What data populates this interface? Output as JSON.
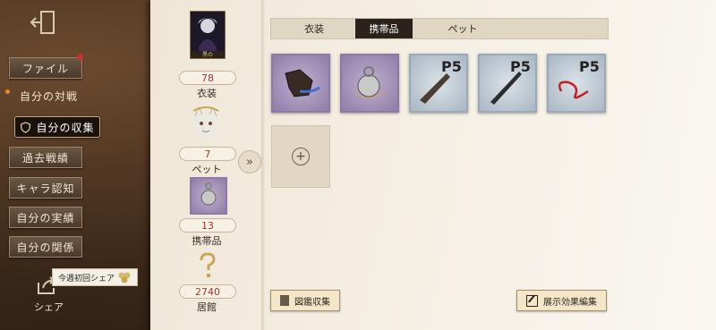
{
  "sidebar": {
    "items": [
      {
        "label": "ファイル"
      },
      {
        "label": "自分の対戦"
      },
      {
        "label": "自分の収集"
      },
      {
        "label": "過去戦績"
      },
      {
        "label": "キャラ認知"
      },
      {
        "label": "自分の実績"
      },
      {
        "label": "自分の関係"
      }
    ],
    "share_tip": "今週初回シェア",
    "share_label": "シェア"
  },
  "stats": {
    "portrait_caption": "黒の",
    "costume": {
      "value": "78",
      "label": "衣装"
    },
    "pet": {
      "value": "7",
      "label": "ペット"
    },
    "accessory": {
      "value": "13",
      "label": "携帯品"
    },
    "residence": {
      "value": "2740",
      "label": "居館"
    }
  },
  "tabs": [
    {
      "label": "衣装"
    },
    {
      "label": "携帯品",
      "active": true
    },
    {
      "label": "ペット"
    }
  ],
  "items": [
    {
      "icon": "bat-wing-accessory-icon",
      "frame": "purple"
    },
    {
      "icon": "pocket-watch-accessory-icon",
      "frame": "purple"
    },
    {
      "icon": "persona5-shotgun-icon",
      "frame": "silver",
      "logo": "P5"
    },
    {
      "icon": "persona5-knife-icon",
      "frame": "silver",
      "logo": "P5"
    },
    {
      "icon": "persona5-whip-icon",
      "frame": "silver",
      "logo": "P5"
    }
  ],
  "buttons": {
    "catalog": "図鑑収集",
    "edit_display": "展示効果編集"
  },
  "colors": {
    "value_red": "#a23a2d",
    "purple_frame": "#8e7aa5",
    "tab_active": "#2a231c"
  }
}
